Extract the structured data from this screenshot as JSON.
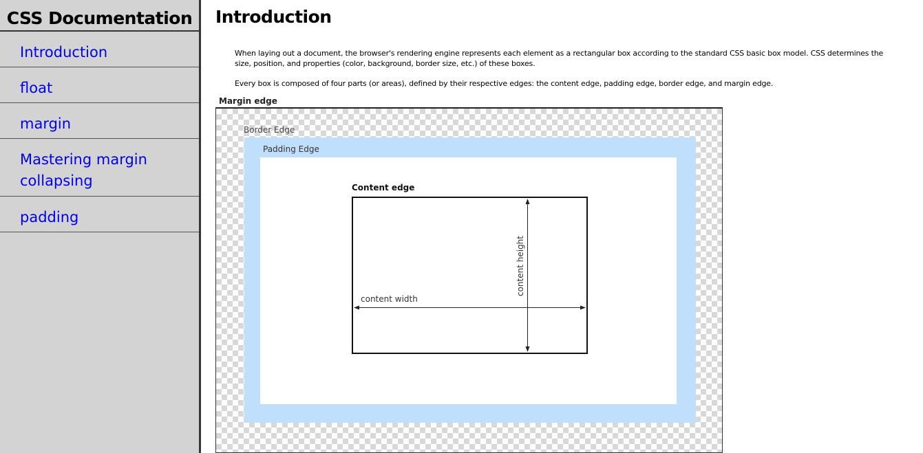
{
  "sidebar": {
    "title": "CSS Documentation",
    "items": [
      {
        "label": "Introduction"
      },
      {
        "label": "float"
      },
      {
        "label": "margin"
      },
      {
        "label": "Mastering margin collapsing"
      },
      {
        "label": "padding"
      }
    ]
  },
  "main": {
    "title": "Introduction",
    "paragraphs": [
      "When laying out a document, the browser's rendering engine represents each element as a rectangular box according to the standard CSS basic box model. CSS determines the size, position, and properties (color, background, border size, etc.) of these boxes.",
      "Every box is composed of four parts (or areas), defined by their respective edges: the content edge, padding edge, border edge, and margin edge."
    ],
    "figure": {
      "margin_label": "Margin edge",
      "border_label": "Border Edge",
      "padding_label": "Padding Edge",
      "content_label": "Content edge",
      "width_label": "content width",
      "height_label": "content height"
    }
  },
  "colors": {
    "sidebar_bg": "#d3d3d3",
    "link": "#0000ee",
    "padding_fill": "#bfdffc"
  }
}
